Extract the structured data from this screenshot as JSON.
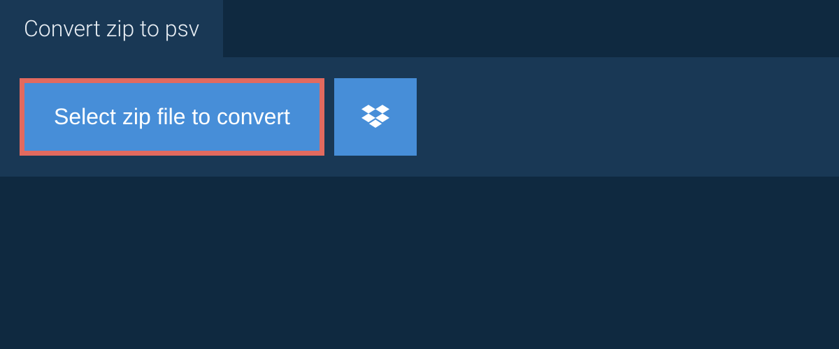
{
  "tab": {
    "label": "Convert zip to psv"
  },
  "actions": {
    "select_file_label": "Select zip file to convert"
  },
  "colors": {
    "background": "#0f2940",
    "panel": "#193855",
    "accent": "#478ed8",
    "highlight_border": "#e26a5f"
  }
}
